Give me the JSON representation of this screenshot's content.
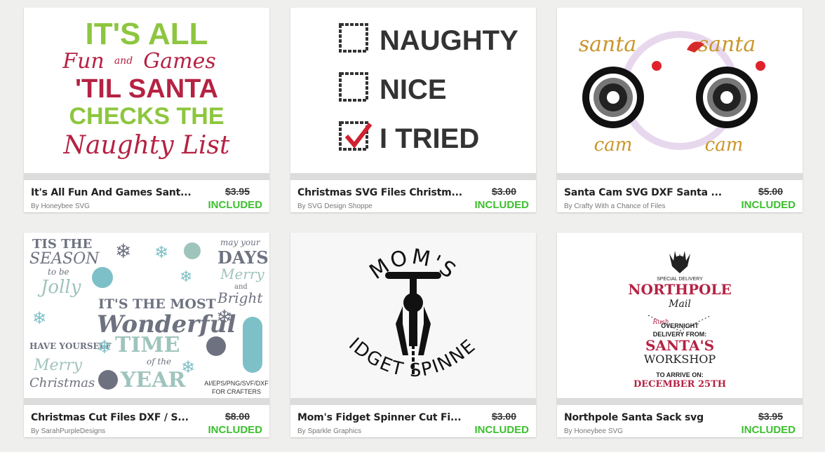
{
  "colors": {
    "included": "#3cbf2e",
    "background": "#efefed"
  },
  "products": [
    {
      "title": "It's All Fun And Games Sant...",
      "author": "By Honeybee SVG",
      "price": "$3.95",
      "status": "INCLUDED",
      "art": {
        "l1": "IT'S ALL",
        "l2": "Fun",
        "l2b": "and",
        "l2c": "Games",
        "l3": "'TIL SANTA",
        "l4": "CHECKS THE",
        "l5": "Naughty List"
      }
    },
    {
      "title": "Christmas SVG Files Christm...",
      "author": "By SVG Design Shoppe",
      "price": "$3.00",
      "status": "INCLUDED",
      "art": {
        "o1": "NAUGHTY",
        "o2": "NICE",
        "o3": "I TRIED"
      }
    },
    {
      "title": "Santa Cam SVG DXF Santa ...",
      "author": "By Crafty With a Chance of Files",
      "price": "$5.00",
      "status": "INCLUDED",
      "art": {
        "s1": "santa",
        "s2": "santa",
        "c1": "cam",
        "c2": "cam"
      }
    },
    {
      "title": "Christmas Cut Files DXF / S...",
      "author": "By SarahPurpleDesigns",
      "price": "$8.00",
      "status": "INCLUDED",
      "art": {
        "t1": "TIS THE",
        "t2": "SEASON",
        "t3": "to be",
        "t4": "Jolly",
        "m1": "IT'S THE MOST",
        "m2": "Wonderful",
        "m3": "TIME",
        "m4": "of the",
        "m5": "YEAR",
        "h1": "HAVE YOURSELF",
        "h2": "Merry",
        "h3": "Christmas",
        "d1": "may your",
        "d2": "DAYS",
        "d3": "Merry",
        "d4": "and",
        "d5": "Bright",
        "f1": "AI/EPS/PNG/SVF/DXF",
        "f2": "FOR CRAFTERS"
      }
    },
    {
      "title": "Mom's Fidget Spinner Cut Fi...",
      "author": "By Sparkle Graphics",
      "price": "$3.00",
      "status": "INCLUDED",
      "art": {
        "top": "MOM'S",
        "bottom": "FIDGET SPINNER"
      }
    },
    {
      "title": "Northpole Santa Sack svg",
      "author": "By Honeybee SVG",
      "price": "$3.95",
      "status": "INCLUDED",
      "art": {
        "a1": "SPECIAL DELIVERY",
        "a2": "NORTHPOLE",
        "a3": "Mail",
        "a4": "Rush",
        "a5": "OVERNIGHT",
        "a6": "DELIVERY FROM:",
        "a7": "SANTA'S",
        "a8": "WORKSHOP",
        "a9": "TO ARRIVE ON:",
        "a10": "DECEMBER 25TH"
      }
    }
  ]
}
